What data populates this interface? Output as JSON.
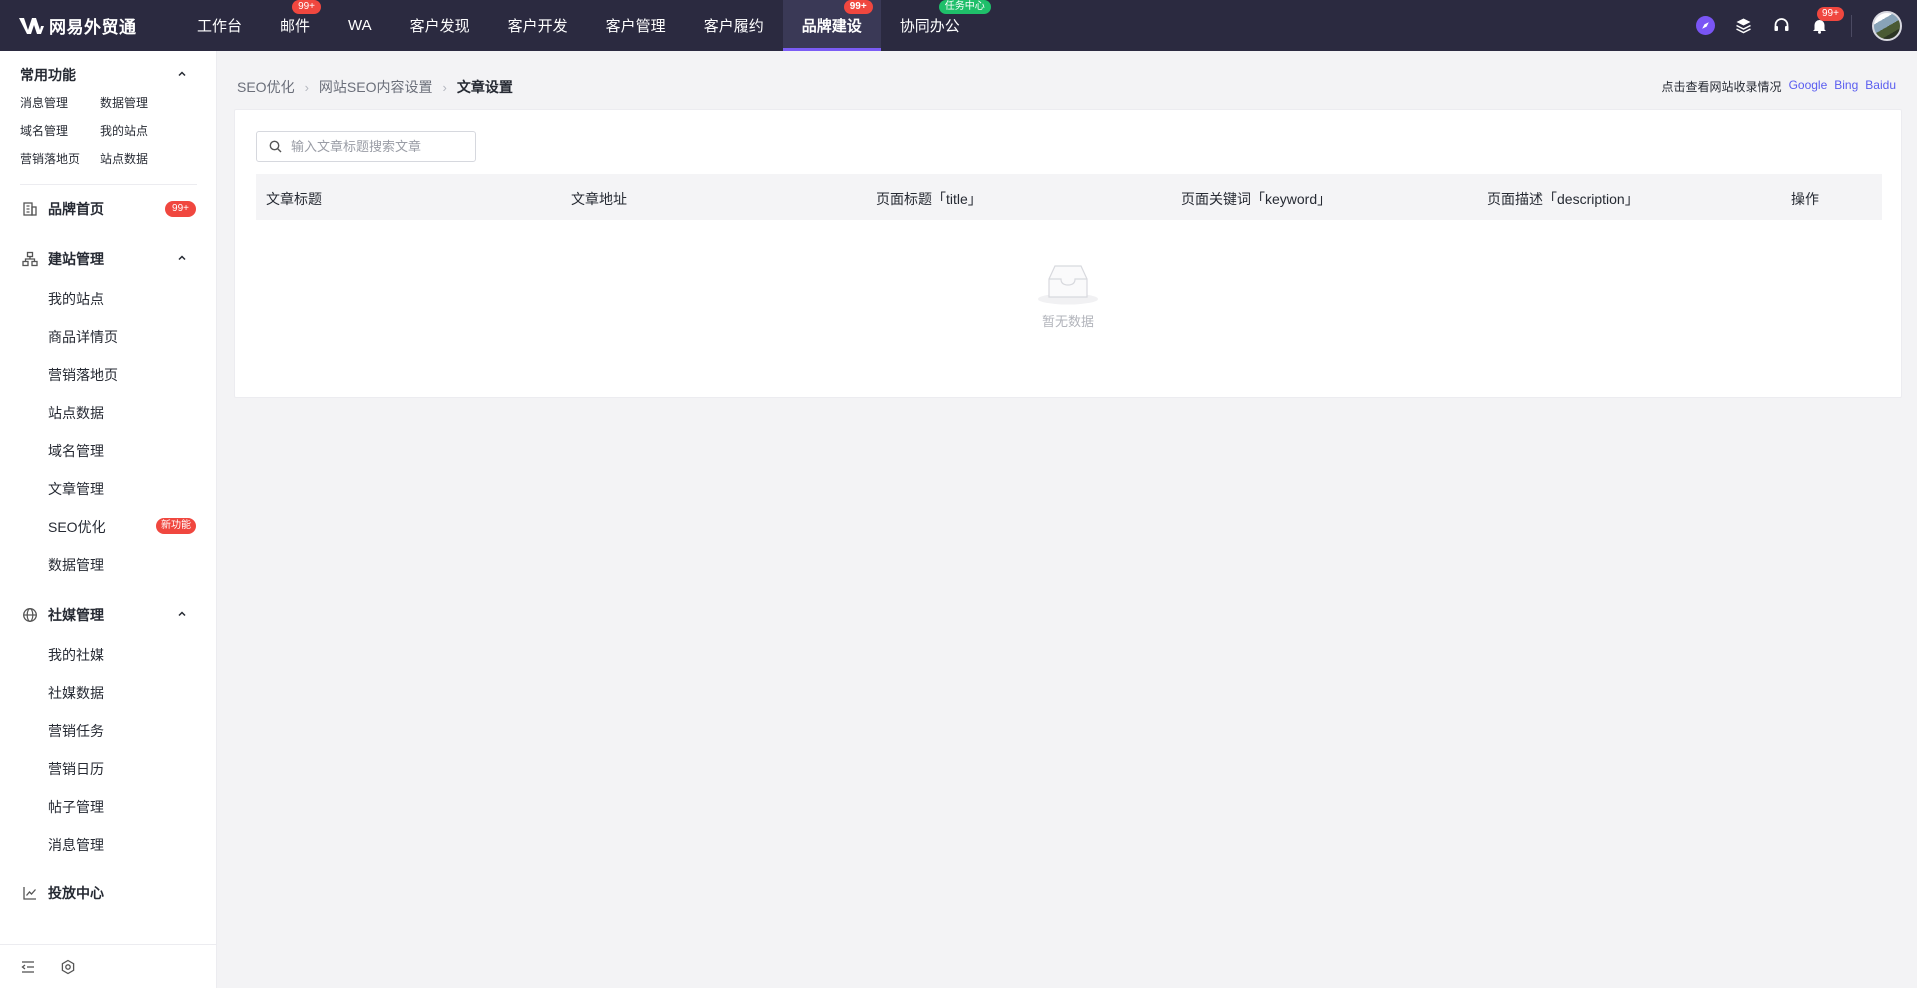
{
  "app": {
    "brand": "网易外贸通"
  },
  "topnav": {
    "items": [
      {
        "label": "工作台",
        "badge": ""
      },
      {
        "label": "邮件",
        "badge": "99+"
      },
      {
        "label": "WA",
        "badge": ""
      },
      {
        "label": "客户发现",
        "badge": ""
      },
      {
        "label": "客户开发",
        "badge": ""
      },
      {
        "label": "客户管理",
        "badge": ""
      },
      {
        "label": "客户履约",
        "badge": ""
      },
      {
        "label": "品牌建设",
        "badge": "99+"
      },
      {
        "label": "协同办公",
        "badge": "任务中心"
      }
    ],
    "active": "品牌建设",
    "notifications_badge": "99+",
    "icons": [
      "compass-icon",
      "layers-icon",
      "headset-icon",
      "bell-icon",
      "avatar"
    ]
  },
  "sidebar": {
    "common": {
      "title": "常用功能",
      "items": [
        "消息管理",
        "数据管理",
        "域名管理",
        "我的站点",
        "营销落地页",
        "站点数据"
      ]
    },
    "brand_home": {
      "label": "品牌首页",
      "badge": "99+"
    },
    "site_mgmt": {
      "label": "建站管理",
      "items": [
        "我的站点",
        "商品详情页",
        "营销落地页",
        "站点数据",
        "域名管理",
        "文章管理",
        "SEO优化",
        "数据管理"
      ],
      "seo_badge": "新功能"
    },
    "social_mgmt": {
      "label": "社媒管理",
      "items": [
        "我的社媒",
        "社媒数据",
        "营销任务",
        "营销日历",
        "帖子管理",
        "消息管理"
      ]
    },
    "ads_center": {
      "label": "投放中心"
    }
  },
  "breadcrumb": {
    "l1": "SEO优化",
    "l2": "网站SEO内容设置",
    "current": "文章设置"
  },
  "indexing": {
    "prefix": "点击查看网站收录情况",
    "links": [
      "Google",
      "Bing",
      "Baidu"
    ]
  },
  "search": {
    "placeholder": "输入文章标题搜索文章",
    "value": ""
  },
  "table": {
    "columns": [
      "文章标题",
      "文章地址",
      "页面标题「title」",
      "页面关键词「keyword」",
      "页面描述「description」",
      "操作"
    ],
    "rows": [],
    "empty_text": "暂无数据"
  },
  "colors": {
    "topbar": "#2b2a40",
    "accent": "#7b5cf5",
    "badge_red": "#f0473f",
    "badge_green": "#1fbf6a",
    "link": "#5a5df0"
  }
}
